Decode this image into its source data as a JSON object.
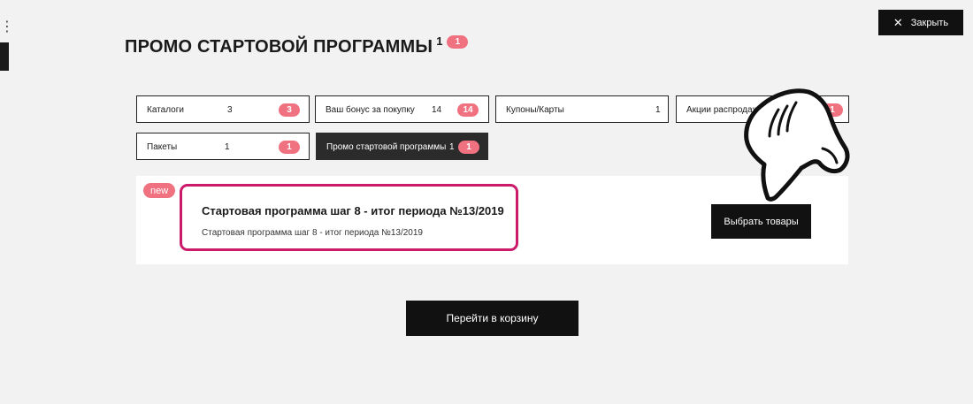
{
  "header": {
    "close_label": "Закрыть",
    "title": "ПРОМО СТАРТОВОЙ ПРОГРАММЫ",
    "title_sup": "1",
    "title_badge": "1"
  },
  "tabs": [
    {
      "label": "Каталоги",
      "count": "3",
      "badge": "3"
    },
    {
      "label": "Ваш бонус за покупку",
      "count": "14",
      "badge": "14"
    },
    {
      "label": "Купоны/Карты",
      "count": "1"
    },
    {
      "label": "Акции распродаж",
      "badge": "1"
    },
    {
      "label": "Пакеты",
      "count": "1",
      "badge": "1"
    },
    {
      "label": "Промо стартовой программы",
      "count": "1",
      "badge": "1",
      "active": true
    }
  ],
  "promo_item": {
    "new_label": "new",
    "title": "Стартовая программа шаг 8 - итог периода №13/2019",
    "subtitle": "Стартовая программа шаг 8 - итог периода №13/2019",
    "choose_label": "Выбрать товары"
  },
  "cart_button_label": "Перейти в корзину",
  "colors": {
    "accent_badge": "#f07180",
    "highlight_border": "#cc1a6b",
    "button_bg": "#111111"
  },
  "icons": {
    "close": "close-icon",
    "pointer": "pointing-hand-icon",
    "menu": "menu-icon"
  }
}
